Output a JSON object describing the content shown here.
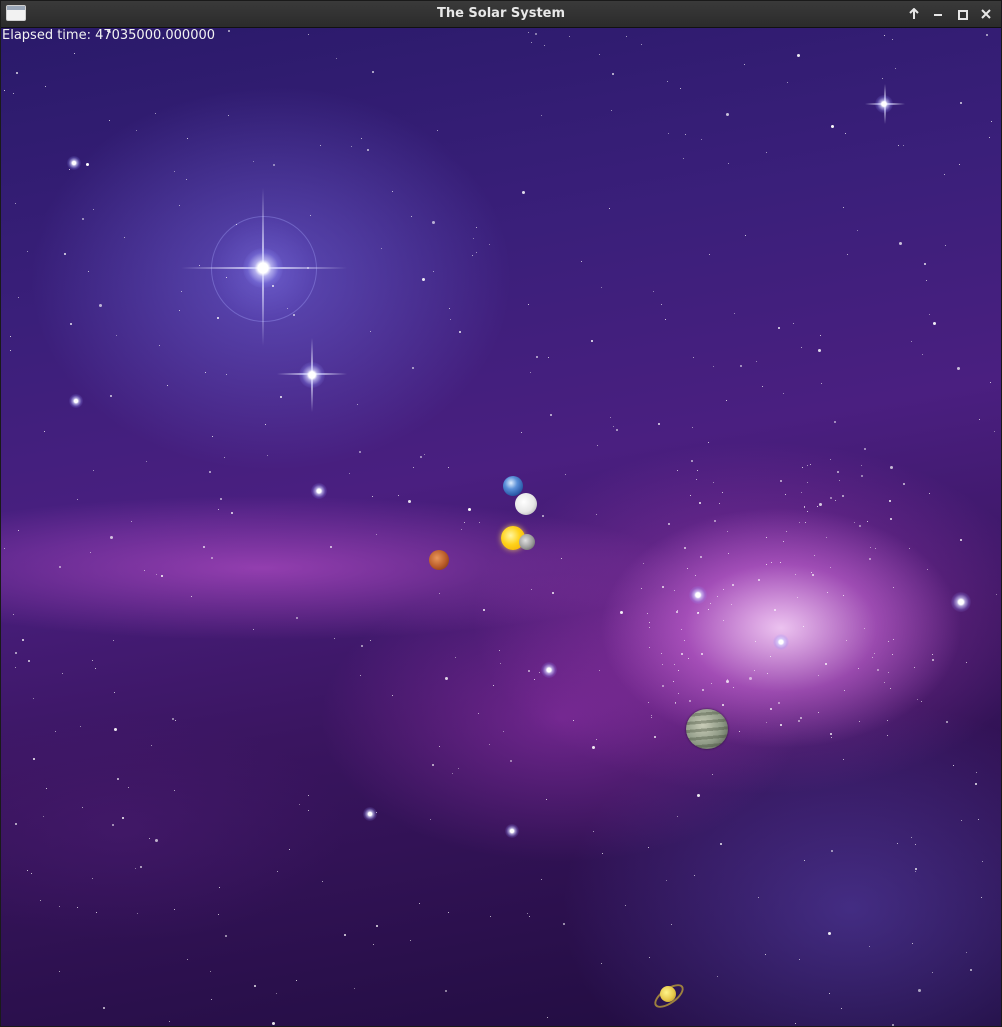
{
  "window": {
    "title": "The Solar System"
  },
  "canvas": {
    "elapsed_text": "Elapsed time: 47035000.000000"
  },
  "icons": {
    "app": "app-window-icon",
    "up": "arrow-up-icon",
    "minimize": "minimize-icon",
    "maximize": "maximize-icon",
    "close": "close-icon"
  },
  "bodies": [
    "sun",
    "earth",
    "moon",
    "mercury",
    "mars",
    "jupiter",
    "saturn"
  ]
}
